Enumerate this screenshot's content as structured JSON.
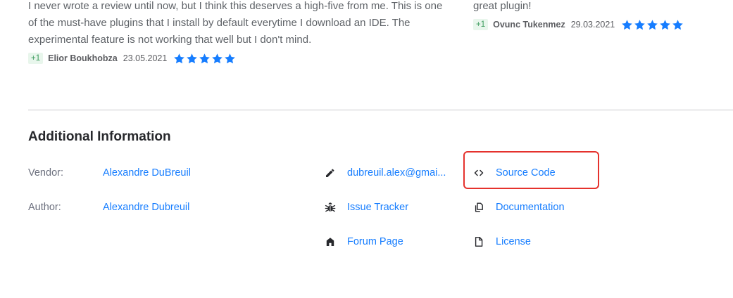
{
  "reviews": [
    {
      "text": "I never wrote a review until now, but I think this deserves a high-five from me. This is one of the must-have plugins that I install by default everytime I download an IDE. The experimental feature is not working that well but I don't mind.",
      "votes": "+1",
      "author": "Elior Boukhobza",
      "date": "23.05.2021",
      "rating": 5
    },
    {
      "text": "great plugin!",
      "votes": "+1",
      "author": "Ovunc Tukenmez",
      "date": "29.03.2021",
      "rating": 5
    }
  ],
  "additional_info": {
    "title": "Additional Information",
    "vendor_label": "Vendor:",
    "vendor_value": "Alexandre DuBreuil",
    "author_label": "Author:",
    "author_value": "Alexandre Dubreuil",
    "email": "dubreuil.alex@gmai...",
    "issue_tracker": "Issue Tracker",
    "forum_page": "Forum Page",
    "source_code": "Source Code",
    "documentation": "Documentation",
    "license": "License"
  },
  "colors": {
    "link": "#167dff",
    "star": "#167dff",
    "highlight": "#e5322d",
    "vote_badge_bg": "#e8f6ec",
    "vote_badge_text": "#3a9a5b"
  },
  "icons": [
    "pencil-icon",
    "bug-icon",
    "home-icon",
    "code-icon",
    "documents-icon",
    "file-icon",
    "star-icon"
  ]
}
